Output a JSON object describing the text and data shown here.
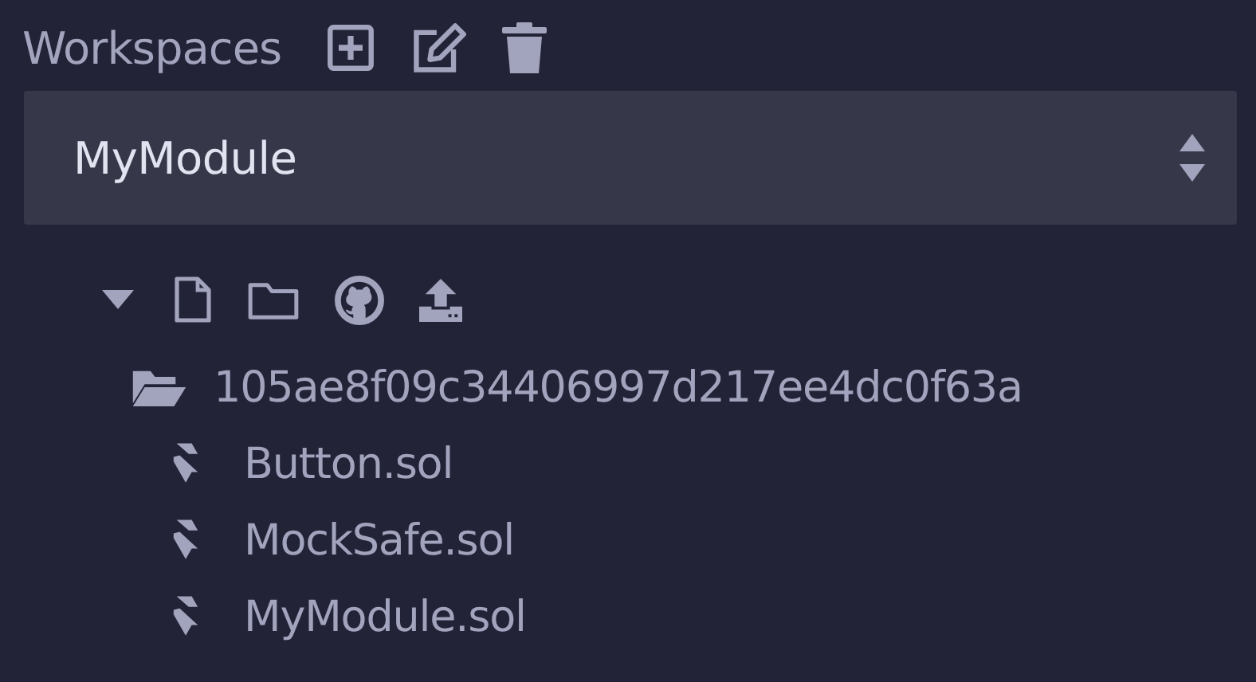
{
  "title": "Workspaces",
  "workspace": {
    "value": "MyModule"
  },
  "tree": {
    "expanded": true,
    "folder": {
      "name": "105ae8f09c34406997d217ee4dc0f63a",
      "expanded": true,
      "children": [
        {
          "name": "Button.sol"
        },
        {
          "name": "MockSafe.sol"
        },
        {
          "name": "MyModule.sol"
        }
      ]
    }
  }
}
